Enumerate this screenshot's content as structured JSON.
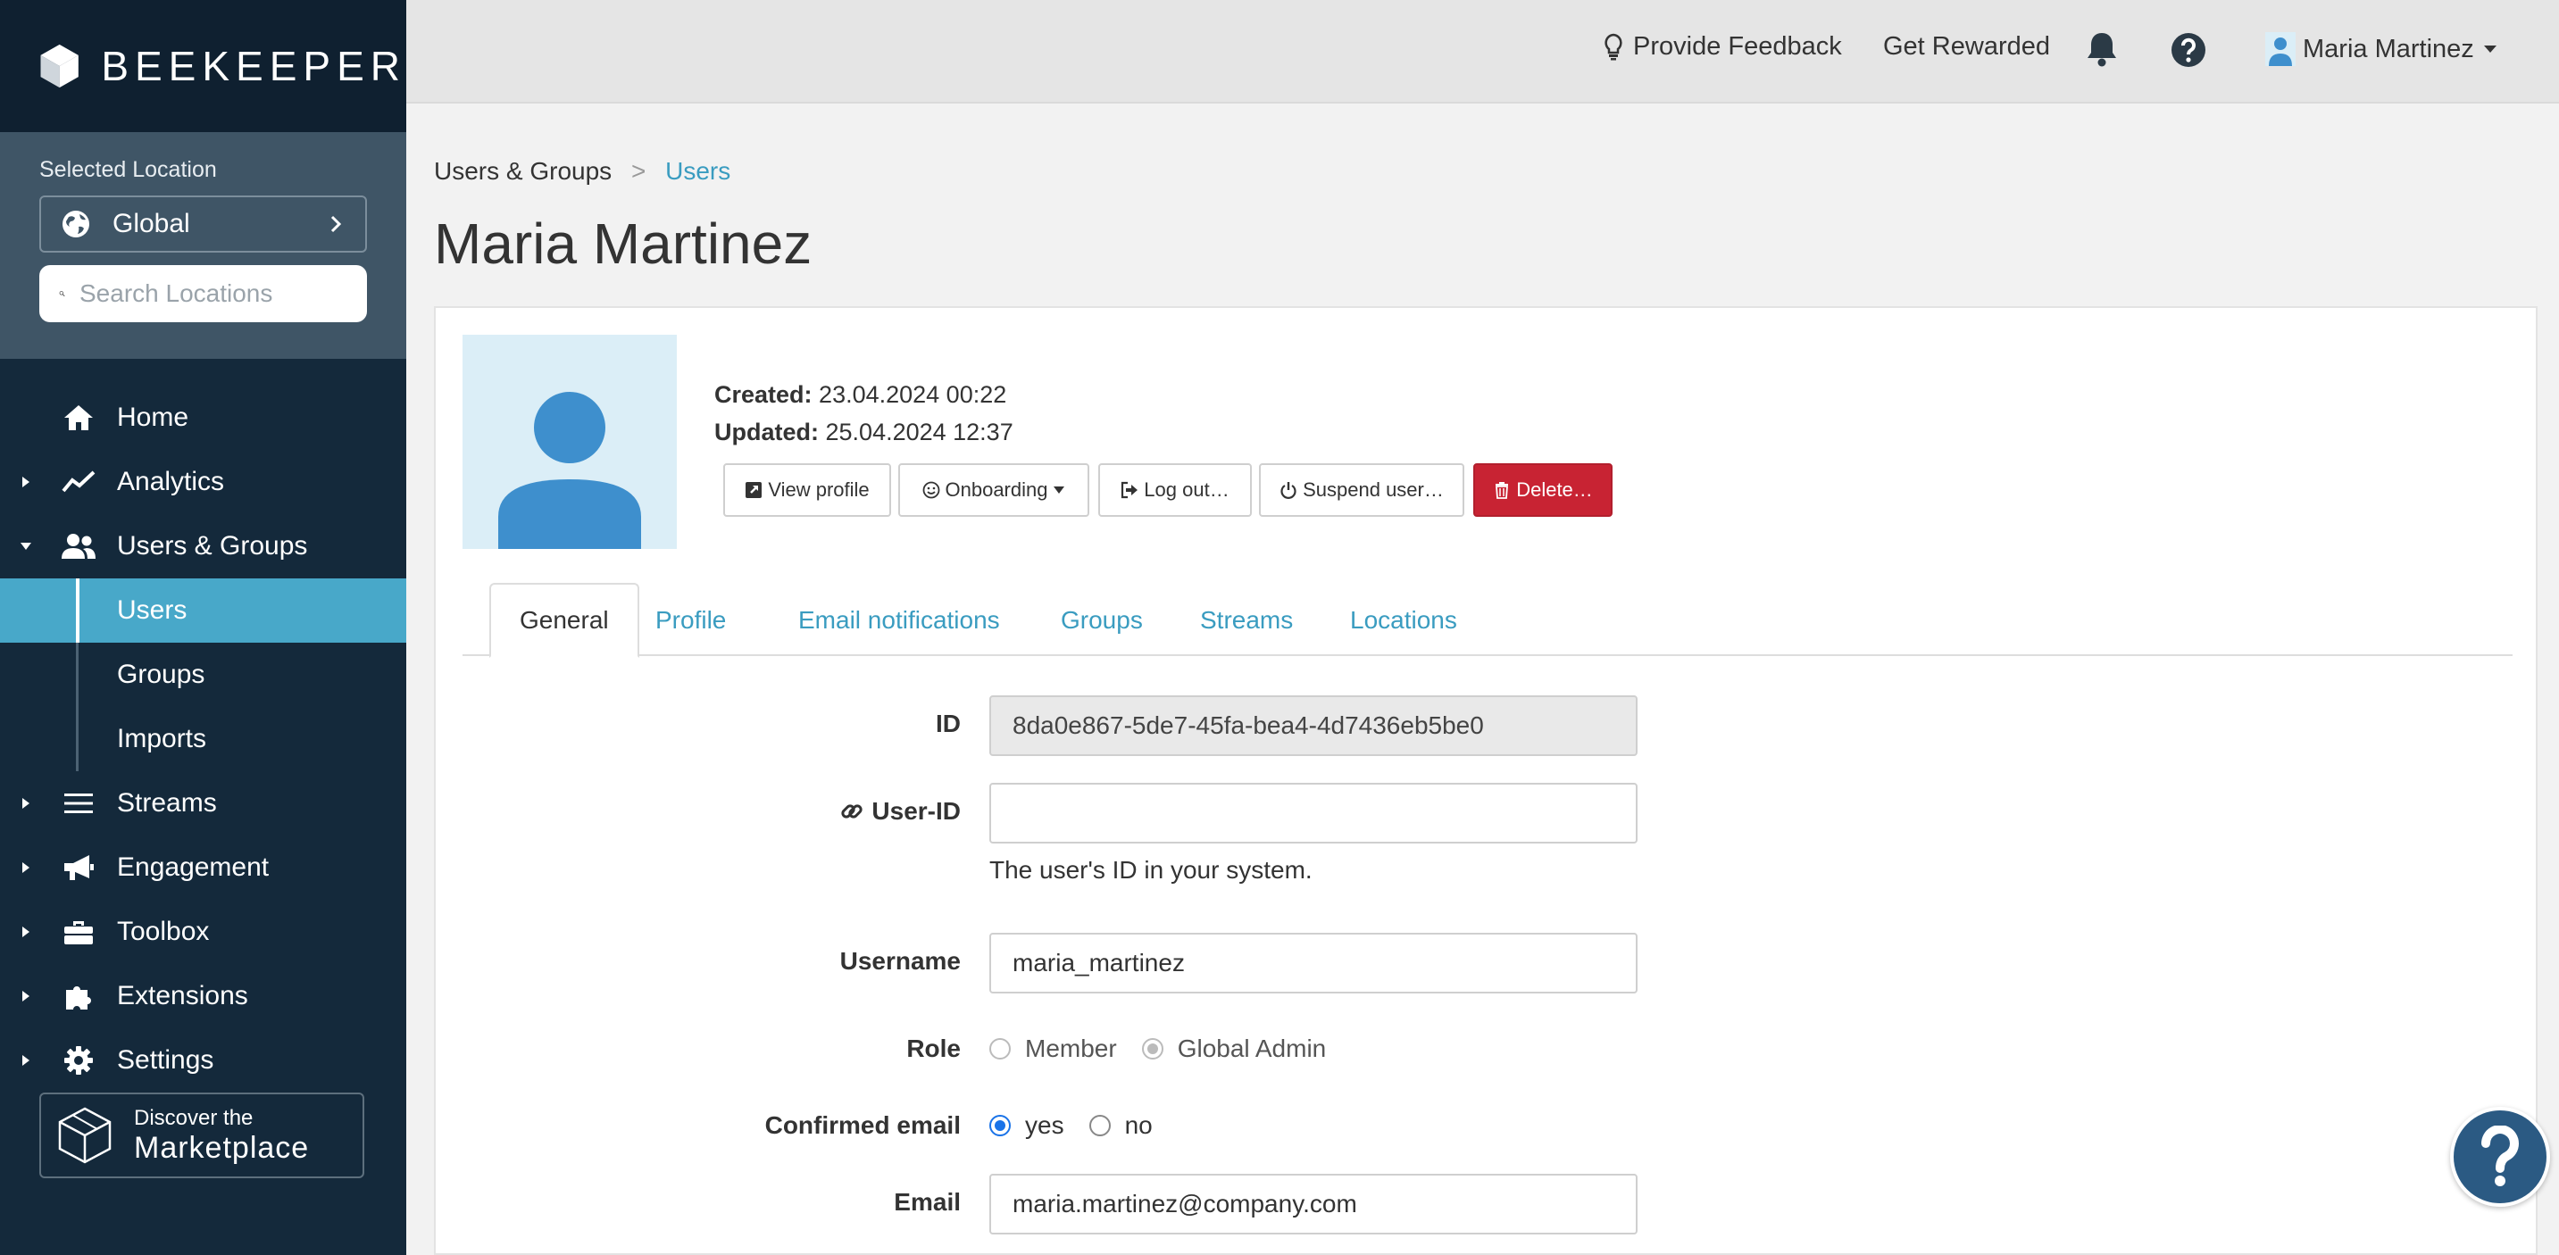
{
  "brand": {
    "name": "BEEKEEPER"
  },
  "location": {
    "caption": "Selected Location",
    "selected": "Global",
    "search_placeholder": "Search Locations"
  },
  "nav": {
    "home": "Home",
    "analytics": "Analytics",
    "users_groups": "Users & Groups",
    "sub": {
      "users": "Users",
      "groups": "Groups",
      "imports": "Imports"
    },
    "streams": "Streams",
    "engagement": "Engagement",
    "toolbox": "Toolbox",
    "extensions": "Extensions",
    "settings": "Settings"
  },
  "marketplace": {
    "line1": "Discover the",
    "line2": "Marketplace"
  },
  "topbar": {
    "feedback": "Provide Feedback",
    "rewarded": "Get Rewarded",
    "user_name": "Maria Martinez"
  },
  "breadcrumb": {
    "parent": "Users & Groups",
    "separator": ">",
    "current": "Users"
  },
  "page_title": "Maria Martinez",
  "user": {
    "created_label": "Created:",
    "created_value": "23.04.2024 00:22",
    "updated_label": "Updated:",
    "updated_value": "25.04.2024 12:37"
  },
  "actions": {
    "view_profile": "View profile",
    "onboarding": "Onboarding",
    "logout": "Log out…",
    "suspend": "Suspend user…",
    "delete": "Delete…"
  },
  "tabs": [
    "General",
    "Profile",
    "Email notifications",
    "Groups",
    "Streams",
    "Locations"
  ],
  "form": {
    "id_label": "ID",
    "id_value": "8da0e867-5de7-45fa-bea4-4d7436eb5be0",
    "user_id_label": "User-ID",
    "user_id_value": "",
    "user_id_hint": "The user's ID in your system.",
    "username_label": "Username",
    "username_value": "maria_martinez",
    "role_label": "Role",
    "role_options": [
      "Member",
      "Global Admin"
    ],
    "role_selected": "Global Admin",
    "confirmed_label": "Confirmed email",
    "confirmed_options": [
      "yes",
      "no"
    ],
    "confirmed_selected": "yes",
    "email_label": "Email",
    "email_value": "maria.martinez@company.com"
  },
  "colors": {
    "sidebar": "#14293b",
    "location_panel": "#3f5566",
    "active_nav": "#48a8c9",
    "link": "#3a9cc0",
    "danger": "#c82333",
    "help_fab": "#2b5a83"
  }
}
